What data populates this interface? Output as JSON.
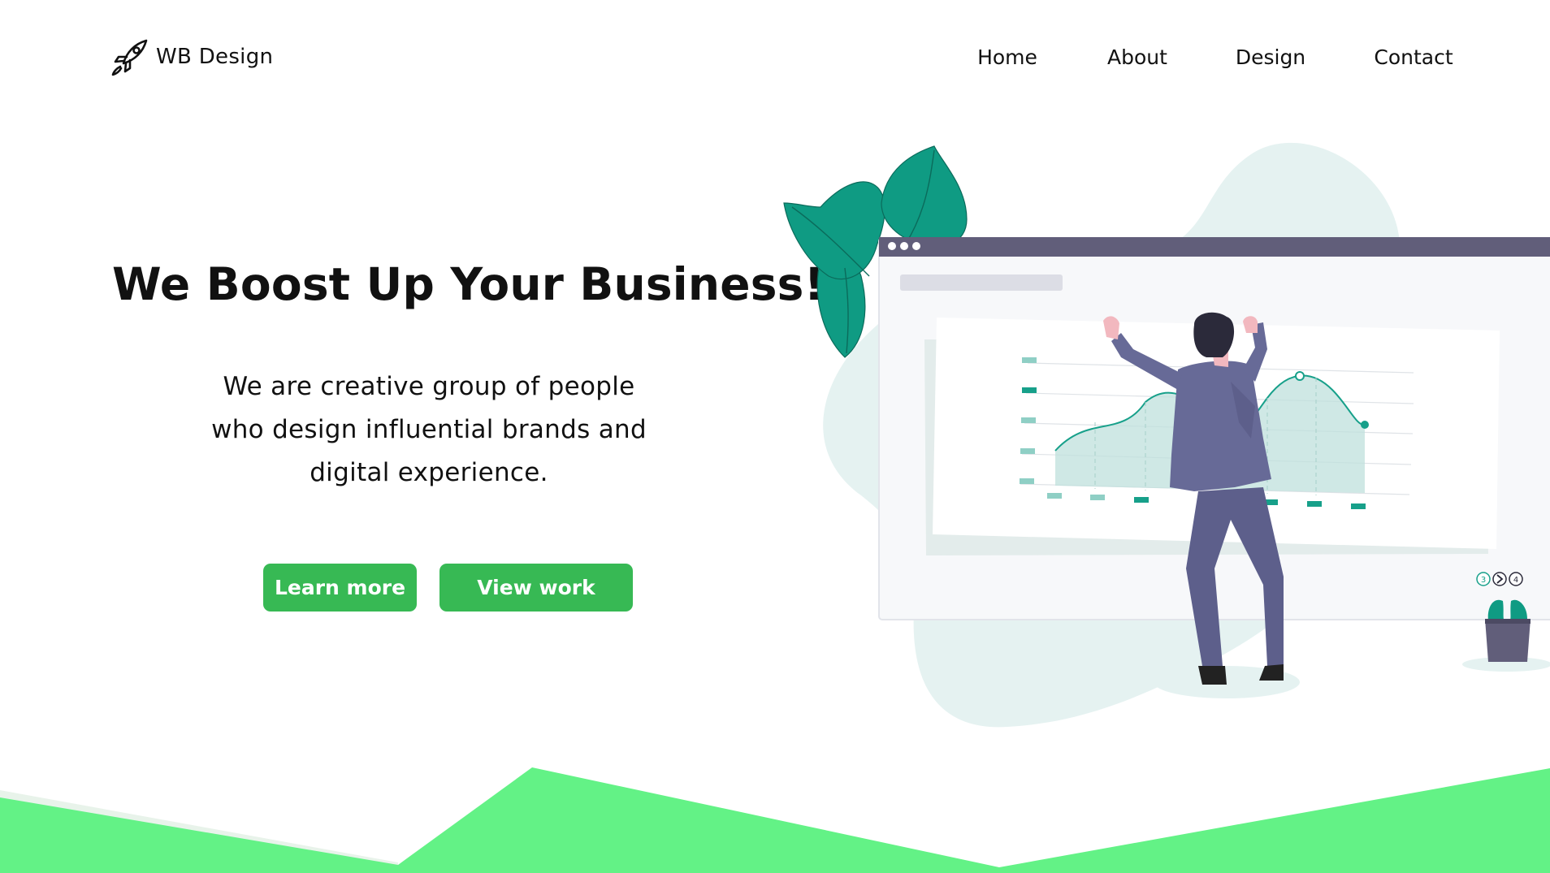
{
  "brand": {
    "name": "WB Design",
    "icon": "rocket-icon"
  },
  "nav": {
    "items": [
      {
        "id": "home",
        "label": "Home"
      },
      {
        "id": "about",
        "label": "About"
      },
      {
        "id": "design",
        "label": "Design"
      },
      {
        "id": "contact",
        "label": "Contact"
      }
    ]
  },
  "hero": {
    "title": "We Boost Up Your Business!",
    "description_lines": [
      "We are creative group of people",
      "who design influential brands and",
      "digital experience."
    ],
    "buttons": {
      "learn_more": "Learn more",
      "view_work": "View work"
    }
  },
  "illustration": {
    "pagination": {
      "prev": "3",
      "next": "4",
      "arrow_icon": "chevron-right-icon"
    }
  },
  "colors": {
    "button": "#37b954",
    "wave": "#63f286",
    "leaf": "#0f9b83",
    "teal": "#17a08a",
    "blob": "#e5f2f1",
    "browser_bar": "#615e7a",
    "suit": "#64668f",
    "text": "#111111"
  }
}
